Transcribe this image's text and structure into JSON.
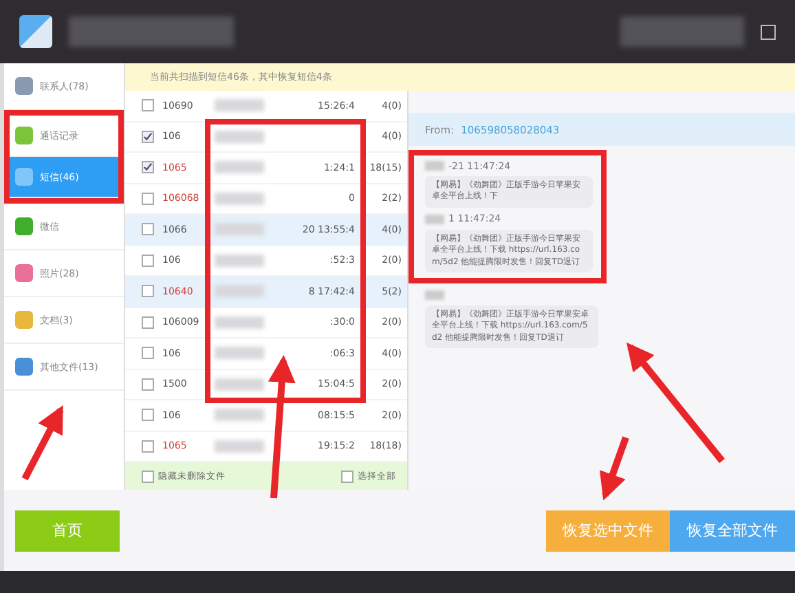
{
  "sidebar": {
    "items": [
      {
        "kind": "contacts",
        "label": "联系人(78)",
        "selected": false
      },
      {
        "kind": "calls",
        "label": "通话记录",
        "selected": false
      },
      {
        "kind": "sms",
        "label": "短信(46)",
        "selected": true
      },
      {
        "kind": "wechat",
        "label": "微信",
        "selected": false
      },
      {
        "kind": "photos",
        "label": "照片(28)",
        "selected": false
      },
      {
        "kind": "docs",
        "label": "文档(3)",
        "selected": false
      },
      {
        "kind": "other",
        "label": "其他文件(13)",
        "selected": false
      }
    ]
  },
  "banner": "当前共扫描到短信46条，其中恢复短信4条",
  "messages": {
    "rows": [
      {
        "number": "10690",
        "time": "15:26:4",
        "count": "4(0)",
        "checked": false,
        "deleted": false,
        "selected": false
      },
      {
        "number": "106",
        "time": "",
        "count": "4(0)",
        "checked": true,
        "deleted": false,
        "selected": false
      },
      {
        "number": "1065",
        "time": "1:24:1",
        "count": "18(15)",
        "checked": true,
        "deleted": true,
        "selected": false
      },
      {
        "number": "106068",
        "time": "0",
        "count": "2(2)",
        "checked": false,
        "deleted": true,
        "selected": false
      },
      {
        "number": "1066",
        "time": "20 13:55:4",
        "count": "4(0)",
        "checked": false,
        "deleted": false,
        "selected": true
      },
      {
        "number": "106",
        "time": ":52:3",
        "count": "2(0)",
        "checked": false,
        "deleted": false,
        "selected": false
      },
      {
        "number": "10640",
        "time": "8 17:42:4",
        "count": "5(2)",
        "checked": false,
        "deleted": true,
        "selected": true
      },
      {
        "number": "106009",
        "time": ":30:0",
        "count": "2(0)",
        "checked": false,
        "deleted": false,
        "selected": false
      },
      {
        "number": "106",
        "time": ":06:3",
        "count": "4(0)",
        "checked": false,
        "deleted": false,
        "selected": false
      },
      {
        "number": "1500",
        "time": "15:04:5",
        "count": "2(0)",
        "checked": false,
        "deleted": false,
        "selected": false
      },
      {
        "number": "106",
        "time": "08:15:5",
        "count": "2(0)",
        "checked": false,
        "deleted": false,
        "selected": false
      },
      {
        "number": "1065",
        "time": "19:15:2",
        "count": "18(18)",
        "checked": false,
        "deleted": true,
        "selected": false
      }
    ],
    "hide_option": {
      "label": "隐藏未删除文件",
      "checked": false
    },
    "select_all": {
      "label": "选择全部",
      "checked": false
    }
  },
  "detail": {
    "from_label": "From:",
    "from_number": "106598058028043",
    "messages": [
      {
        "date": "-21 11:47:24",
        "text": "【网易】《劲舞团》正版手游今日苹果安卓全平台上线！下"
      },
      {
        "date": "1 11:47:24",
        "text": "【网易】《劲舞团》正版手游今日苹果安卓全平台上线！下载 https://url.163.com/5d2 他能提腾限时发售！回复TD退订"
      },
      {
        "text": "【网易】《劲舞团》正版手游今日苹果安卓全平台上线！下载 https://url.163.com/5d2 他能提腾限时发售！回复TD退订"
      }
    ]
  },
  "footer": {
    "home_button": "首页",
    "recover_selected_button": "恢复选中文件",
    "recover_all_button": "恢复全部文件"
  }
}
